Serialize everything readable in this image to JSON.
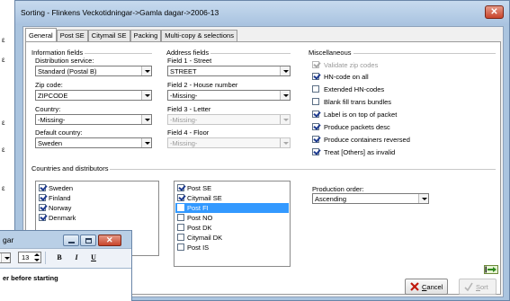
{
  "background_window": {
    "fragments": [
      "ε",
      "ε",
      "ε",
      "ε",
      "ε"
    ]
  },
  "dialog": {
    "title": "Sorting - Flinkens Veckotidningar->Gamla dagar->2006-13",
    "close_glyph": "✕",
    "tabs": [
      {
        "label": "General",
        "active": true
      },
      {
        "label": "Post SE",
        "active": false
      },
      {
        "label": "Citymail SE",
        "active": false
      },
      {
        "label": "Packing",
        "active": false
      },
      {
        "label": "Multi-copy & selections",
        "active": false
      }
    ],
    "info": {
      "header": "Information fields",
      "distribution_label": "Distribution service:",
      "distribution_value": "Standard (Postal B)",
      "zip_label": "Zip code:",
      "zip_value": "ZIPCODE",
      "country_label": "Country:",
      "country_value": "-Missing-",
      "default_country_label": "Default country:",
      "default_country_value": "Sweden"
    },
    "address": {
      "header": "Address fields",
      "field1_label": "Field 1 - Street",
      "field1_value": "STREET",
      "field2_label": "Field 2 - House number",
      "field2_value": "-Missing-",
      "field3_label": "Field 3 - Letter",
      "field3_value": "-Missing-",
      "field4_label": "Field 4 - Floor",
      "field4_value": "-Missing-"
    },
    "misc": {
      "header": "Miscellaneous",
      "options": [
        {
          "label": "Validate zip codes",
          "checked": true,
          "disabled": true
        },
        {
          "label": "HN-code on all",
          "checked": true,
          "disabled": false
        },
        {
          "label": "Extended HN-codes",
          "checked": false,
          "disabled": false
        },
        {
          "label": "Blank fill trans bundles",
          "checked": false,
          "disabled": false
        },
        {
          "label": "Label is on top of packet",
          "checked": true,
          "disabled": false
        },
        {
          "label": "Produce packets desc",
          "checked": true,
          "disabled": false
        },
        {
          "label": "Produce containers reversed",
          "checked": true,
          "disabled": false
        },
        {
          "label": "Treat [Others] as invalid",
          "checked": true,
          "disabled": false
        }
      ]
    },
    "countries": {
      "header": "Countries and distributors",
      "countries_list": [
        {
          "label": "Sweden",
          "checked": true
        },
        {
          "label": "Finland",
          "checked": true
        },
        {
          "label": "Norway",
          "checked": true
        },
        {
          "label": "Denmark",
          "checked": true
        }
      ],
      "distributors_list": [
        {
          "label": "Post SE",
          "checked": true,
          "selected": false
        },
        {
          "label": "Citymail SE",
          "checked": true,
          "selected": false
        },
        {
          "label": "Post FI",
          "checked": false,
          "selected": true
        },
        {
          "label": "Post NO",
          "checked": false,
          "selected": false
        },
        {
          "label": "Post DK",
          "checked": false,
          "selected": false
        },
        {
          "label": "Citymail DK",
          "checked": false,
          "selected": false
        },
        {
          "label": "Post IS",
          "checked": false,
          "selected": false
        }
      ]
    },
    "production_order": {
      "label": "Production order:",
      "value": "Ascending"
    },
    "buttons": {
      "cancel_underlined": "C",
      "cancel_rest": "ancel",
      "sort_underlined": "S",
      "sort_rest": "ort"
    }
  },
  "editor": {
    "title": "gar",
    "font_size": "13",
    "bold": "B",
    "italic": "I",
    "underline": "U",
    "content_line": "er before starting"
  }
}
